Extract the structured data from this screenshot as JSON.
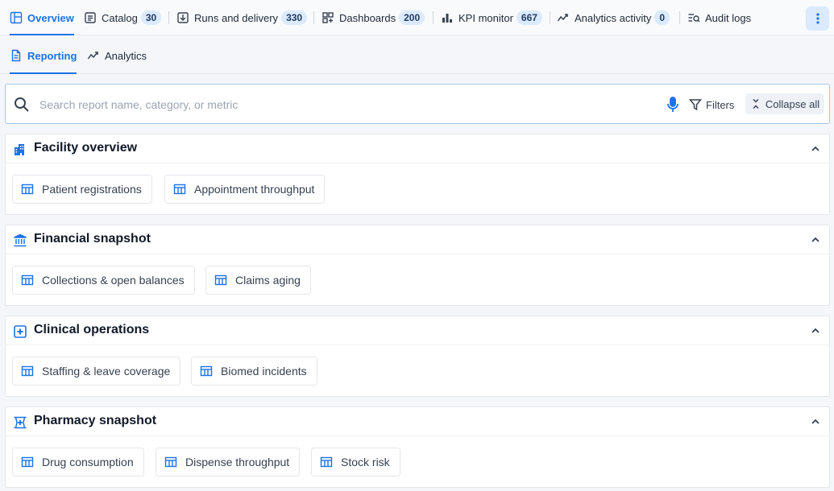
{
  "nav": {
    "tabs": [
      {
        "label": "Overview",
        "badge": null,
        "icon": "layout-icon"
      },
      {
        "label": "Catalog",
        "badge": "30",
        "icon": "list-icon"
      },
      {
        "label": "Runs and delivery",
        "badge": "330",
        "icon": "export-icon"
      },
      {
        "label": "Dashboards",
        "badge": "200",
        "icon": "dashboard-icon"
      },
      {
        "label": "KPI monitor",
        "badge": "667",
        "icon": "bar-chart-icon"
      },
      {
        "label": "Analytics activity",
        "badge": "0",
        "icon": "trend-icon"
      },
      {
        "label": "Audit logs",
        "badge": null,
        "icon": "audit-icon"
      }
    ]
  },
  "subnav": {
    "tabs": [
      {
        "label": "Reporting",
        "icon": "document-icon"
      },
      {
        "label": "Analytics",
        "icon": "trend-icon"
      }
    ]
  },
  "search": {
    "placeholder": "Search report name, category, or metric",
    "filters_label": "Filters",
    "collapse_label": "Collapse all"
  },
  "sections": [
    {
      "title": "Facility overview",
      "icon": "building-icon",
      "reports": [
        "Patient registrations",
        "Appointment throughput"
      ]
    },
    {
      "title": "Financial snapshot",
      "icon": "bank-icon",
      "reports": [
        "Collections & open balances",
        "Claims aging"
      ]
    },
    {
      "title": "Clinical operations",
      "icon": "medical-plus-icon",
      "reports": [
        "Staffing & leave coverage",
        "Biomed incidents"
      ]
    },
    {
      "title": "Pharmacy snapshot",
      "icon": "pharmacy-icon",
      "reports": [
        "Drug consumption",
        "Dispense throughput",
        "Stock risk"
      ]
    }
  ],
  "colors": {
    "accent": "#1a73e8",
    "badge_bg": "#dbeafe"
  }
}
